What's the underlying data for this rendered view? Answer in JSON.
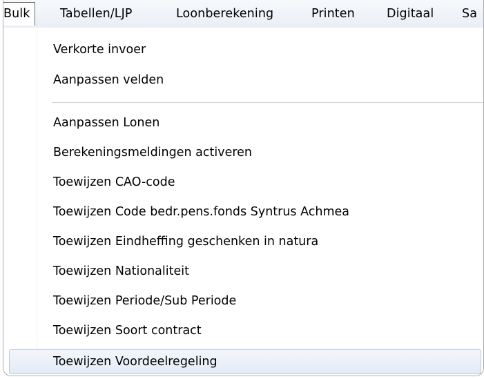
{
  "menubar": {
    "items": [
      {
        "label": "Bulk"
      },
      {
        "label": "Tabellen/LJP"
      },
      {
        "label": "Loonberekening"
      },
      {
        "label": "Printen"
      },
      {
        "label": "Digitaal"
      },
      {
        "label": "Sa"
      }
    ]
  },
  "menu": {
    "group1": [
      {
        "label": "Verkorte invoer"
      },
      {
        "label": "Aanpassen velden"
      }
    ],
    "group2": [
      {
        "label": "Aanpassen Lonen"
      },
      {
        "label": "Berekeningsmeldingen activeren"
      },
      {
        "label": "Toewijzen CAO-code"
      },
      {
        "label": "Toewijzen Code bedr.pens.fonds Syntrus Achmea"
      },
      {
        "label": "Toewijzen Eindheffing geschenken in natura"
      },
      {
        "label": "Toewijzen Nationaliteit"
      },
      {
        "label": "Toewijzen Periode/Sub Periode"
      },
      {
        "label": "Toewijzen Soort contract"
      },
      {
        "label": "Toewijzen Voordeelregeling"
      }
    ]
  },
  "colors": {
    "hover_border": "#b9c8e0",
    "hover_fill": "#e4ebf6",
    "active_border": "#6c6c6c"
  }
}
